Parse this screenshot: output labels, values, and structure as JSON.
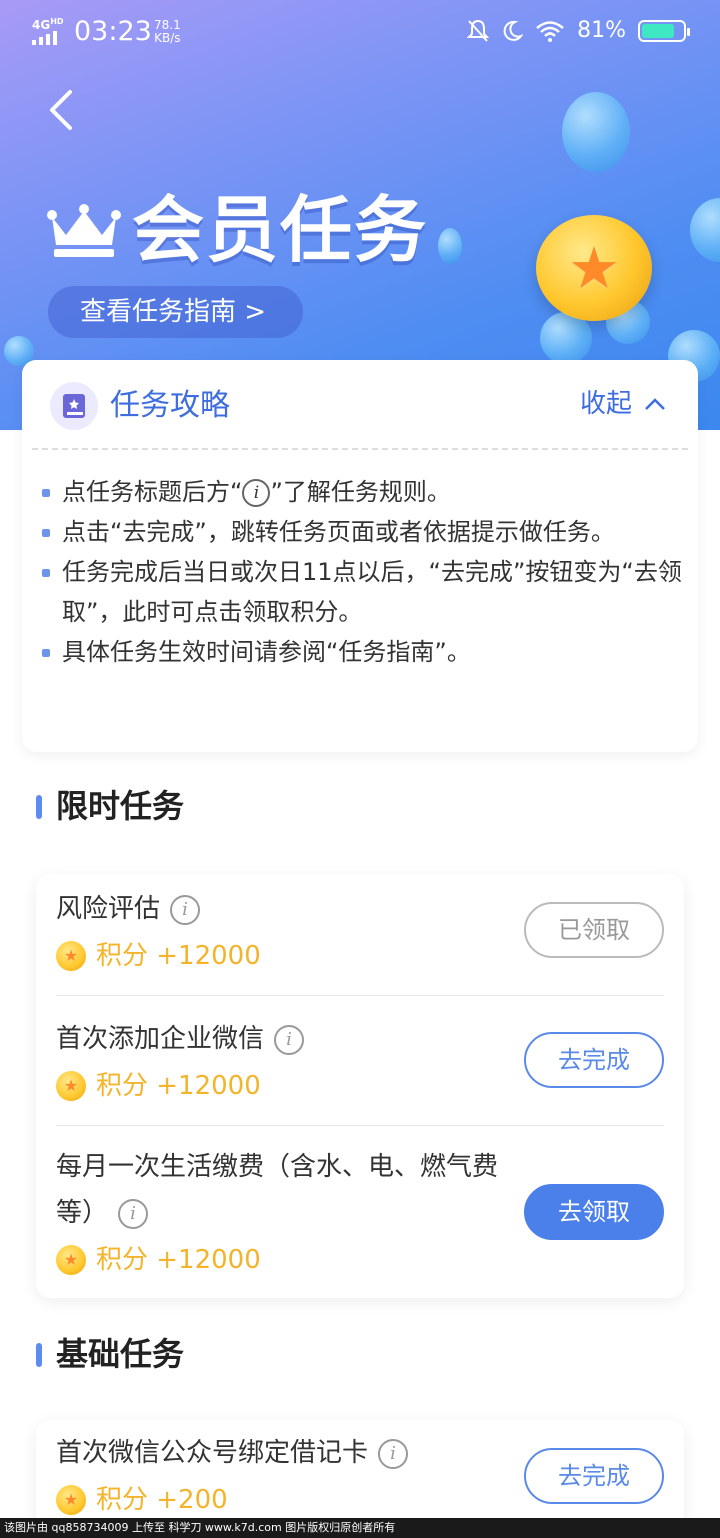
{
  "status_bar": {
    "network": "4G",
    "network_sup": "HD",
    "time": "03:23",
    "speed_value": "78.1",
    "speed_unit": "KB/s",
    "battery": "81%",
    "battery_level": 0.81
  },
  "header": {
    "title": "会员任务",
    "guide_button": "查看任务指南 >",
    "colors": {
      "gradient_start": "#a89af6",
      "gradient_end": "#3b88ee"
    }
  },
  "strategy": {
    "title": "任务攻略",
    "collapse_label": "收起",
    "bullets": {
      "b1_before": "点任务标题后方“",
      "b1_icon": "i",
      "b1_after": "”了解任务规则。",
      "b2": "点击“去完成”，跳转任务页面或者依据提示做任务。",
      "b3": "任务完成后当日或次日11点以后，“去完成”按钮变为“去领取”，此时可点击领取积分。",
      "b4": "具体任务生效时间请参阅“任务指南”。"
    }
  },
  "limited": {
    "section_title": "限时任务",
    "tasks": [
      {
        "name": "风险评估",
        "points": "积分 +12000",
        "button": "已领取"
      },
      {
        "name": "首次添加企业微信",
        "points": "积分 +12000",
        "button": "去完成"
      },
      {
        "name": "每月一次生活缴费（含水、电、燃气费等）",
        "points": "积分 +12000",
        "button": "去领取"
      }
    ]
  },
  "basic": {
    "section_title": "基础任务",
    "tasks": [
      {
        "name": "首次微信公众号绑定借记卡",
        "points": "积分 +200",
        "button": "去完成"
      }
    ]
  },
  "watermark": "该图片由 qq858734009 上传至 科学刀 www.k7d.com 图片版权归原创者所有",
  "accent_color": "#4b80ea",
  "points_color": "#f4b42a"
}
